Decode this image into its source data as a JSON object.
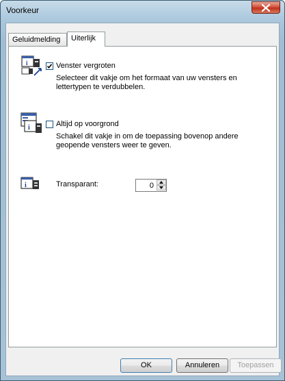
{
  "window": {
    "title": "Voorkeur"
  },
  "tabs": [
    {
      "label": "Geluidmelding",
      "active": false
    },
    {
      "label": "Uiterlijk",
      "active": true
    }
  ],
  "options": [
    {
      "label": "Venster vergroten",
      "checked": true,
      "description": "Selecteer dit vakje om het formaat van uw vensters en lettertypen te verdubbelen.",
      "icon": "enlarge-window-icon"
    },
    {
      "label": "Altijd op voorgrond",
      "checked": false,
      "description": "Schakel dit vakje in om de toepassing bovenop andere geopende vensters weer te geven.",
      "icon": "always-on-top-icon"
    }
  ],
  "transparency": {
    "label": "Transparant:",
    "value": "0",
    "icon": "transparency-icon"
  },
  "buttons": {
    "ok": "OK",
    "cancel": "Annuleren",
    "apply": "Toepassen"
  },
  "colors": {
    "close_button": "#c0311b",
    "frame": "#a9c6dc"
  }
}
